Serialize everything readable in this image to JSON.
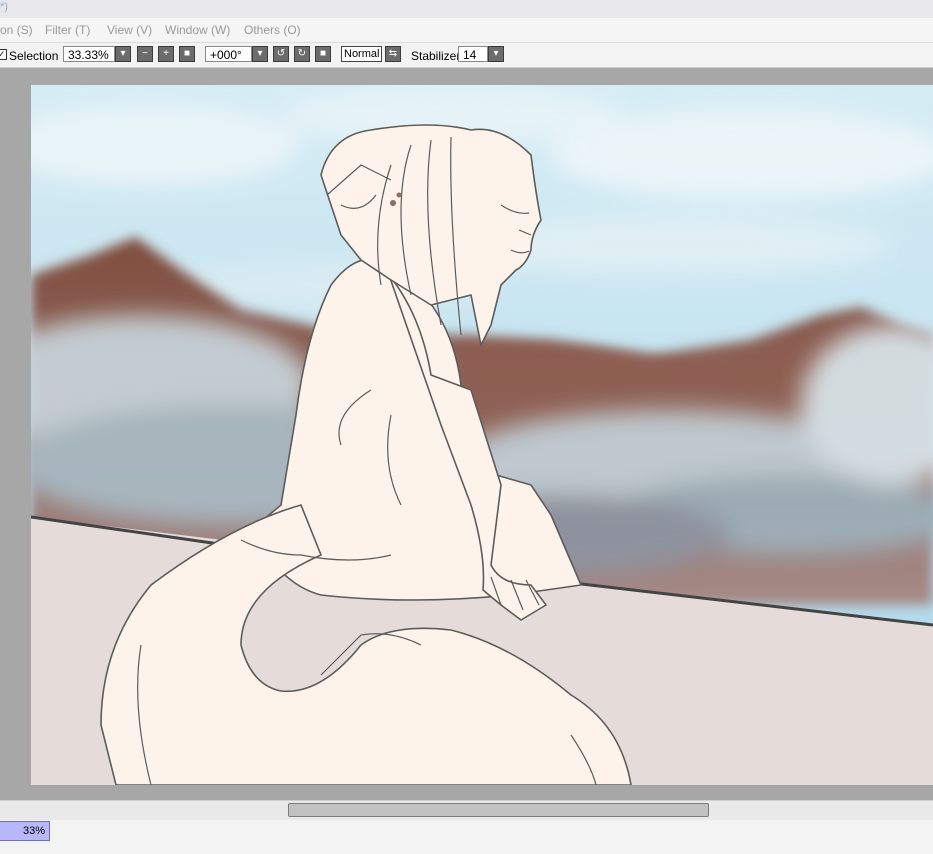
{
  "titlebar": {
    "text": "*)"
  },
  "menu": [
    {
      "label": "on (S)"
    },
    {
      "label": "Filter (T)"
    },
    {
      "label": "View (V)"
    },
    {
      "label": "Window (W)"
    },
    {
      "label": "Others (O)"
    }
  ],
  "toolbar": {
    "selection_checked": true,
    "selection_label": "Selection",
    "zoom_value": "33.33%",
    "rotation_value": "+000°",
    "blend_mode": "Normal",
    "stabilizer_label": "Stabilizer",
    "stabilizer_value": "14"
  },
  "status": {
    "zoom_percent": "33%"
  },
  "colors": {
    "workspace": "#a7a7a7",
    "status_accent": "#b7b7fa",
    "sky": "#c6e3ef",
    "mountain": "#8a5a4c",
    "skin": "#fdf3ea",
    "ledge": "#e4dcda"
  }
}
